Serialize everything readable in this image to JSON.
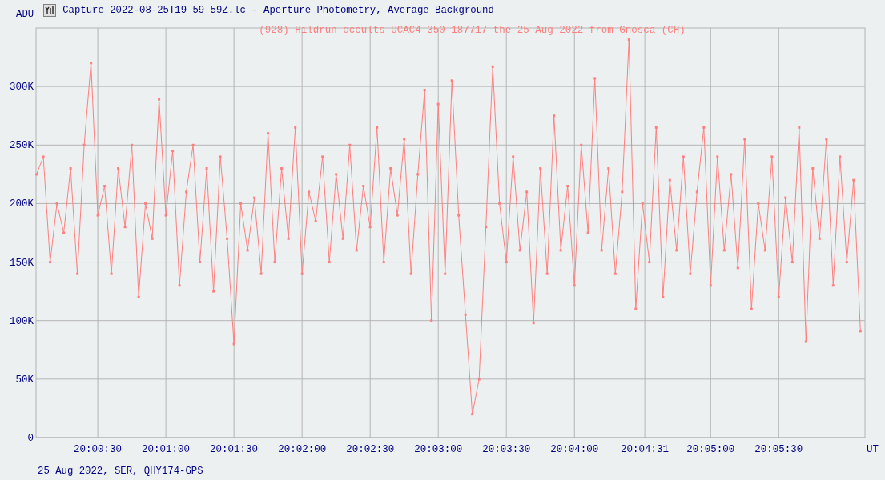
{
  "window": {
    "title": "Capture 2022-08-25T19_59_59Z.lc - Aperture Photometry, Average Background"
  },
  "y_unit": "ADU",
  "x_unit": "UT",
  "footer": "25 Aug 2022, SER, QHY174-GPS",
  "chart_data": {
    "type": "line",
    "title": "(928) Hildrun occults UCAC4 350-187717 the 25 Aug 2022 from Gnosca (CH)",
    "grid": true,
    "xlim": [
      72002.8,
      72368
    ],
    "ylim": [
      0,
      350
    ],
    "xticks": [
      {
        "value": 72030,
        "label": "20:00:30"
      },
      {
        "value": 72060,
        "label": "20:01:00"
      },
      {
        "value": 72090,
        "label": "20:01:30"
      },
      {
        "value": 72120,
        "label": "20:02:00"
      },
      {
        "value": 72150,
        "label": "20:02:30"
      },
      {
        "value": 72180,
        "label": "20:03:00"
      },
      {
        "value": 72210,
        "label": "20:03:30"
      },
      {
        "value": 72240,
        "label": "20:04:00"
      },
      {
        "value": 72271,
        "label": "20:04:31"
      },
      {
        "value": 72300,
        "label": "20:05:00"
      },
      {
        "value": 72330,
        "label": "20:05:30"
      }
    ],
    "yticks": [
      {
        "value": 0,
        "label": "0"
      },
      {
        "value": 50,
        "label": "50K"
      },
      {
        "value": 100,
        "label": "100K"
      },
      {
        "value": 150,
        "label": "150K"
      },
      {
        "value": 200,
        "label": "200K"
      },
      {
        "value": 250,
        "label": "250K"
      },
      {
        "value": 300,
        "label": "300K"
      }
    ],
    "x": [
      72003,
      72006,
      72009,
      72012,
      72015,
      72018,
      72021,
      72024,
      72027,
      72030,
      72033,
      72036,
      72039,
      72042,
      72045,
      72048,
      72051,
      72054,
      72057,
      72060,
      72063,
      72066,
      72069,
      72072,
      72075,
      72078,
      72081,
      72084,
      72087,
      72090,
      72093,
      72096,
      72099,
      72102,
      72105,
      72108,
      72111,
      72114,
      72117,
      72120,
      72123,
      72126,
      72129,
      72132,
      72135,
      72138,
      72141,
      72144,
      72147,
      72150,
      72153,
      72156,
      72159,
      72162,
      72165,
      72168,
      72171,
      72174,
      72177,
      72180,
      72183,
      72186,
      72189,
      72192,
      72195,
      72198,
      72201,
      72204,
      72207,
      72210,
      72213,
      72216,
      72219,
      72222,
      72225,
      72228,
      72231,
      72234,
      72237,
      72240,
      72243,
      72246,
      72249,
      72252,
      72255,
      72258,
      72261,
      72264,
      72267,
      72270,
      72273,
      72276,
      72279,
      72282,
      72285,
      72288,
      72291,
      72294,
      72297,
      72300,
      72303,
      72306,
      72309,
      72312,
      72315,
      72318,
      72321,
      72324,
      72327,
      72330,
      72333,
      72336,
      72339,
      72342,
      72345,
      72348,
      72351,
      72354,
      72357,
      72360,
      72363,
      72366
    ],
    "series": [
      {
        "color": "#ff7f7f",
        "values": [
          225,
          240,
          150,
          200,
          175,
          230,
          140,
          250,
          320,
          190,
          215,
          140,
          230,
          180,
          250,
          120,
          200,
          170,
          289,
          190,
          245,
          130,
          210,
          250,
          150,
          230,
          125,
          240,
          170,
          80,
          200,
          160,
          205,
          140,
          260,
          150,
          230,
          170,
          265,
          140,
          210,
          185,
          240,
          150,
          225,
          170,
          250,
          160,
          215,
          180,
          265,
          150,
          230,
          190,
          255,
          140,
          225,
          297,
          100,
          285,
          140,
          305,
          190,
          105,
          20,
          50,
          180,
          317,
          200,
          150,
          240,
          160,
          210,
          98,
          230,
          140,
          275,
          160,
          215,
          130,
          250,
          175,
          307,
          160,
          230,
          140,
          210,
          340,
          110,
          200,
          150,
          265,
          120,
          220,
          160,
          240,
          140,
          210,
          265,
          130,
          240,
          160,
          225,
          145,
          255,
          110,
          200,
          160,
          240,
          120,
          205,
          150,
          265,
          82,
          230,
          170,
          255,
          130,
          240,
          150,
          220,
          91
        ]
      }
    ]
  }
}
